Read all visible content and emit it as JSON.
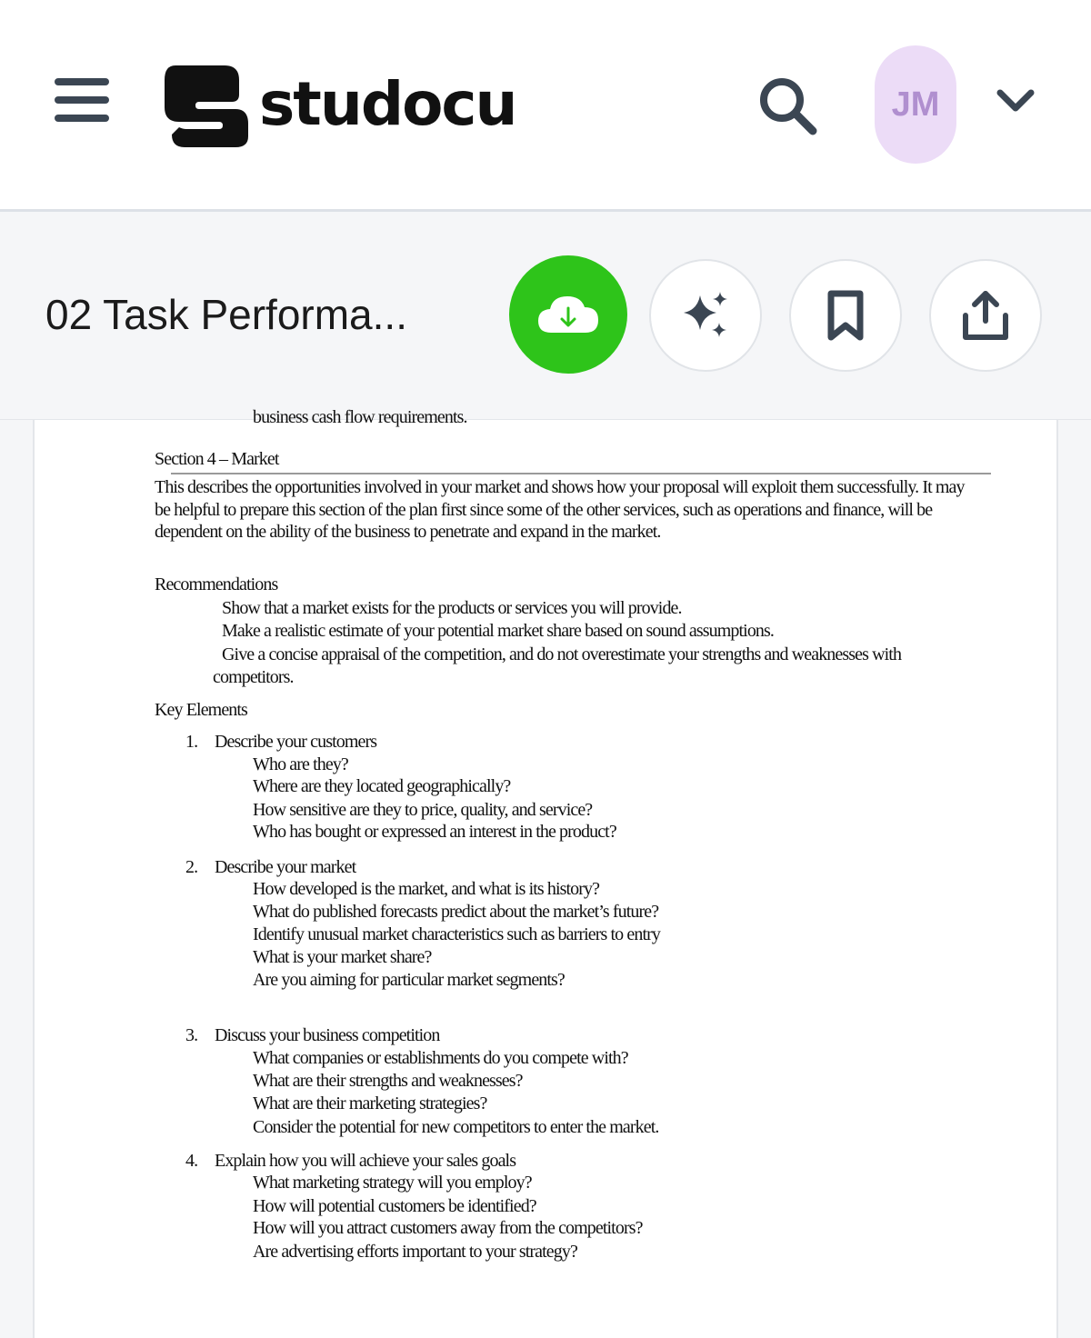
{
  "header": {
    "logo_text": "studocu",
    "avatar_initials": "JM",
    "icons": {
      "menu": "hamburger-menu-icon",
      "search": "search-icon",
      "chevron": "chevron-down-icon"
    }
  },
  "toolbar": {
    "doc_title": "02 Task Performa...",
    "buttons": {
      "download": "cloud-download-icon",
      "ai": "sparkles-icon",
      "bookmark": "bookmark-icon",
      "share": "share-icon"
    },
    "colors": {
      "download_bg": "#2ec41a"
    }
  },
  "doc": {
    "cut_line": "business cash flow requirements.",
    "section_heading": "Section 4 – Market",
    "intro": "This describes the opportunities involved in your market and shows how your proposal will exploit them successfully. It may be helpful to prepare this section of the plan first since some of the other services, such as operations and finance, will be dependent on the ability of the business to penetrate and expand in the market.",
    "recommendations_label": "Recommendations",
    "recommendations": [
      "Show that a market exists for the products or services you will provide.",
      "Make a realistic estimate of your potential market share based on sound assumptions.",
      "Give a concise appraisal of the competition, and do not overestimate your strengths and weaknesses with competitors."
    ],
    "key_elements_label": "Key Elements",
    "elements": [
      {
        "num": "1.",
        "title": "Describe your customers",
        "questions": [
          "Who are they?",
          "Where are they located geographically?",
          "How sensitive are they to price, quality, and service?",
          "Who has bought or expressed an interest in the product?"
        ]
      },
      {
        "num": "2.",
        "title": "Describe your market",
        "questions": [
          "How developed is the market, and what is its history?",
          "What do published forecasts predict about the market’s future?",
          "Identify unusual market characteristics such as barriers to entry",
          "What is your market share?",
          "Are you aiming for particular market segments?"
        ]
      },
      {
        "num": "3.",
        "title": "Discuss your business competition",
        "questions": [
          "What companies or establishments do you compete with?",
          "What are their strengths and weaknesses?",
          "What are their marketing strategies?",
          "Consider the potential for new competitors to enter the market."
        ]
      },
      {
        "num": "4.",
        "title": "Explain how you will achieve your sales goals",
        "questions": [
          "What marketing strategy will you employ?",
          "How will potential customers be identified?",
          "How will you attract customers away from the competitors?",
          "Are advertising efforts important to your strategy?"
        ]
      }
    ]
  }
}
